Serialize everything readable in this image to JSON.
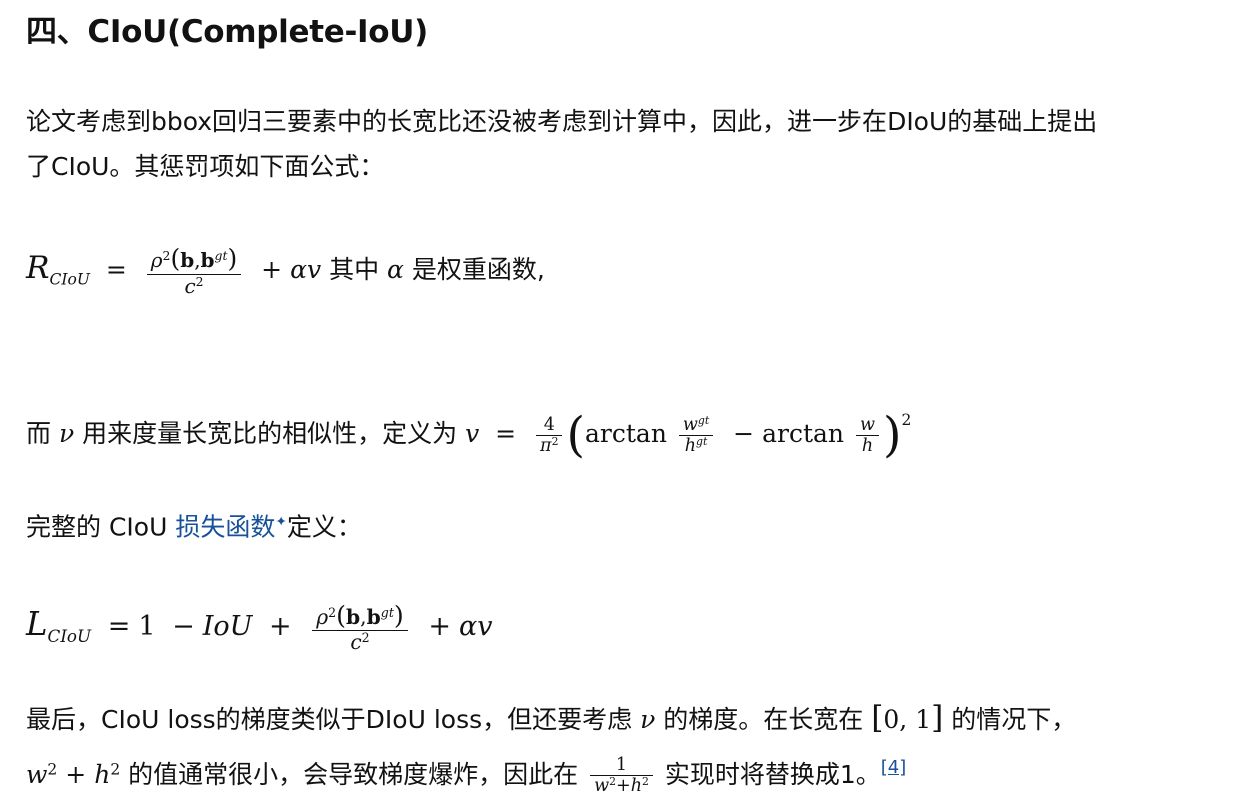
{
  "heading": "四、CIoU(Complete-IoU)",
  "para1": {
    "line1": "论文考虑到bbox回归三要素中的长宽比还没被考虑到计算中，因此，进一步在DIoU的基础上提出",
    "line2": "了CIoU。其惩罚项如下面公式："
  },
  "formula_r": {
    "symbol": "R",
    "subscript": "CIoU",
    "equals": "=",
    "rho": "ρ",
    "exp2": "2",
    "b": "b",
    "comma": ",",
    "gt": "gt",
    "c": "c",
    "plus": "+",
    "alpha": "α",
    "v": "v",
    "text_mid": " 其中 ",
    "text_end": " 是权重函数,"
  },
  "formula_v": {
    "text_before": "而 ",
    "nu": "ν",
    "text_mid": " 用来度量长宽比的相似性，定义为",
    "v": "v",
    "equals": "=",
    "four": "4",
    "pi": "π",
    "exp2": "2",
    "arctan": "arctan",
    "w": "w",
    "h": "h",
    "gt": "gt",
    "minus": "−"
  },
  "para3": {
    "text_before": "完整的 CIoU ",
    "link": "损失函数",
    "spark": "✦",
    "text_after": "定义："
  },
  "formula_l": {
    "symbol": "L",
    "subscript": "CIoU",
    "equals": "=",
    "one": "1",
    "minus": "−",
    "iou": "IoU",
    "plus": "+",
    "rho": "ρ",
    "exp2": "2",
    "b": "b",
    "comma": ",",
    "gt": "gt",
    "c": "c",
    "alpha": "α",
    "v": "v"
  },
  "para4": {
    "line1_a": "最后，CIoU loss的梯度类似于DIoU loss，但还要考虑 ",
    "nu": "ν",
    "line1_b": " 的梯度。在长宽在 ",
    "interval_open": "[",
    "interval_body": "0, 1",
    "interval_close": "]",
    "line1_c": " 的情况下，",
    "w": "w",
    "h": "h",
    "exp2": "2",
    "plus": "+",
    "line2_a": " 的值通常很小，会导致梯度爆炸，因此在 ",
    "one": "1",
    "line2_b": " 实现时将替换成1。",
    "ref": "[4]"
  }
}
